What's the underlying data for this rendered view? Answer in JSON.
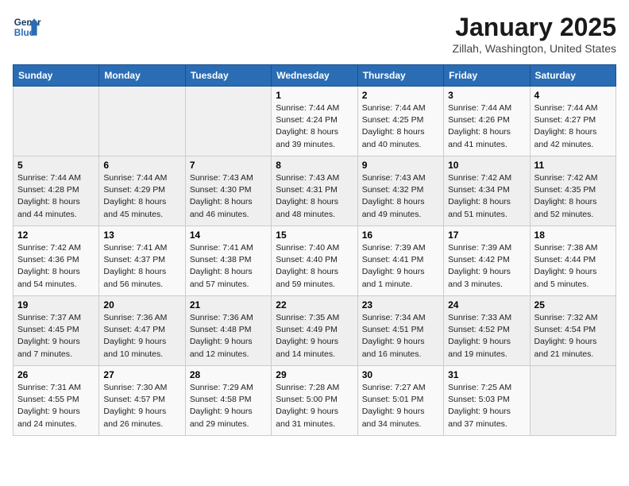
{
  "header": {
    "logo_line1": "General",
    "logo_line2": "Blue",
    "month": "January 2025",
    "location": "Zillah, Washington, United States"
  },
  "weekdays": [
    "Sunday",
    "Monday",
    "Tuesday",
    "Wednesday",
    "Thursday",
    "Friday",
    "Saturday"
  ],
  "weeks": [
    [
      {
        "day": "",
        "info": ""
      },
      {
        "day": "",
        "info": ""
      },
      {
        "day": "",
        "info": ""
      },
      {
        "day": "1",
        "info": "Sunrise: 7:44 AM\nSunset: 4:24 PM\nDaylight: 8 hours\nand 39 minutes."
      },
      {
        "day": "2",
        "info": "Sunrise: 7:44 AM\nSunset: 4:25 PM\nDaylight: 8 hours\nand 40 minutes."
      },
      {
        "day": "3",
        "info": "Sunrise: 7:44 AM\nSunset: 4:26 PM\nDaylight: 8 hours\nand 41 minutes."
      },
      {
        "day": "4",
        "info": "Sunrise: 7:44 AM\nSunset: 4:27 PM\nDaylight: 8 hours\nand 42 minutes."
      }
    ],
    [
      {
        "day": "5",
        "info": "Sunrise: 7:44 AM\nSunset: 4:28 PM\nDaylight: 8 hours\nand 44 minutes."
      },
      {
        "day": "6",
        "info": "Sunrise: 7:44 AM\nSunset: 4:29 PM\nDaylight: 8 hours\nand 45 minutes."
      },
      {
        "day": "7",
        "info": "Sunrise: 7:43 AM\nSunset: 4:30 PM\nDaylight: 8 hours\nand 46 minutes."
      },
      {
        "day": "8",
        "info": "Sunrise: 7:43 AM\nSunset: 4:31 PM\nDaylight: 8 hours\nand 48 minutes."
      },
      {
        "day": "9",
        "info": "Sunrise: 7:43 AM\nSunset: 4:32 PM\nDaylight: 8 hours\nand 49 minutes."
      },
      {
        "day": "10",
        "info": "Sunrise: 7:42 AM\nSunset: 4:34 PM\nDaylight: 8 hours\nand 51 minutes."
      },
      {
        "day": "11",
        "info": "Sunrise: 7:42 AM\nSunset: 4:35 PM\nDaylight: 8 hours\nand 52 minutes."
      }
    ],
    [
      {
        "day": "12",
        "info": "Sunrise: 7:42 AM\nSunset: 4:36 PM\nDaylight: 8 hours\nand 54 minutes."
      },
      {
        "day": "13",
        "info": "Sunrise: 7:41 AM\nSunset: 4:37 PM\nDaylight: 8 hours\nand 56 minutes."
      },
      {
        "day": "14",
        "info": "Sunrise: 7:41 AM\nSunset: 4:38 PM\nDaylight: 8 hours\nand 57 minutes."
      },
      {
        "day": "15",
        "info": "Sunrise: 7:40 AM\nSunset: 4:40 PM\nDaylight: 8 hours\nand 59 minutes."
      },
      {
        "day": "16",
        "info": "Sunrise: 7:39 AM\nSunset: 4:41 PM\nDaylight: 9 hours\nand 1 minute."
      },
      {
        "day": "17",
        "info": "Sunrise: 7:39 AM\nSunset: 4:42 PM\nDaylight: 9 hours\nand 3 minutes."
      },
      {
        "day": "18",
        "info": "Sunrise: 7:38 AM\nSunset: 4:44 PM\nDaylight: 9 hours\nand 5 minutes."
      }
    ],
    [
      {
        "day": "19",
        "info": "Sunrise: 7:37 AM\nSunset: 4:45 PM\nDaylight: 9 hours\nand 7 minutes."
      },
      {
        "day": "20",
        "info": "Sunrise: 7:36 AM\nSunset: 4:47 PM\nDaylight: 9 hours\nand 10 minutes."
      },
      {
        "day": "21",
        "info": "Sunrise: 7:36 AM\nSunset: 4:48 PM\nDaylight: 9 hours\nand 12 minutes."
      },
      {
        "day": "22",
        "info": "Sunrise: 7:35 AM\nSunset: 4:49 PM\nDaylight: 9 hours\nand 14 minutes."
      },
      {
        "day": "23",
        "info": "Sunrise: 7:34 AM\nSunset: 4:51 PM\nDaylight: 9 hours\nand 16 minutes."
      },
      {
        "day": "24",
        "info": "Sunrise: 7:33 AM\nSunset: 4:52 PM\nDaylight: 9 hours\nand 19 minutes."
      },
      {
        "day": "25",
        "info": "Sunrise: 7:32 AM\nSunset: 4:54 PM\nDaylight: 9 hours\nand 21 minutes."
      }
    ],
    [
      {
        "day": "26",
        "info": "Sunrise: 7:31 AM\nSunset: 4:55 PM\nDaylight: 9 hours\nand 24 minutes."
      },
      {
        "day": "27",
        "info": "Sunrise: 7:30 AM\nSunset: 4:57 PM\nDaylight: 9 hours\nand 26 minutes."
      },
      {
        "day": "28",
        "info": "Sunrise: 7:29 AM\nSunset: 4:58 PM\nDaylight: 9 hours\nand 29 minutes."
      },
      {
        "day": "29",
        "info": "Sunrise: 7:28 AM\nSunset: 5:00 PM\nDaylight: 9 hours\nand 31 minutes."
      },
      {
        "day": "30",
        "info": "Sunrise: 7:27 AM\nSunset: 5:01 PM\nDaylight: 9 hours\nand 34 minutes."
      },
      {
        "day": "31",
        "info": "Sunrise: 7:25 AM\nSunset: 5:03 PM\nDaylight: 9 hours\nand 37 minutes."
      },
      {
        "day": "",
        "info": ""
      }
    ]
  ]
}
